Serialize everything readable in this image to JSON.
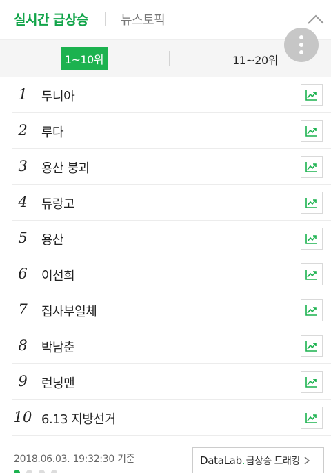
{
  "header": {
    "tab_active": "실시간 급상승",
    "tab_inactive": "뉴스토픽"
  },
  "range": {
    "active": "1~10위",
    "inactive": "11~20위"
  },
  "keywords": [
    {
      "rank": "1",
      "text": "두니아"
    },
    {
      "rank": "2",
      "text": "루다"
    },
    {
      "rank": "3",
      "text": "용산 붕괴"
    },
    {
      "rank": "4",
      "text": "듀랑고"
    },
    {
      "rank": "5",
      "text": "용산"
    },
    {
      "rank": "6",
      "text": "이선희"
    },
    {
      "rank": "7",
      "text": "집사부일체"
    },
    {
      "rank": "8",
      "text": "박남춘"
    },
    {
      "rank": "9",
      "text": "런닝맨"
    },
    {
      "rank": "10",
      "text": "6.13 지방선거"
    }
  ],
  "footer": {
    "timestamp": "2018.06.03. 19:32:30 기준",
    "datalab_brand": "DataLab",
    "datalab_dot": ".",
    "datalab_label": "급상승 트래킹",
    "page_dots": 4,
    "active_dot": 0
  },
  "colors": {
    "accent": "#1cb24f",
    "tab_active": "#11a449"
  },
  "icons": {
    "collapse": "chevron-up-icon",
    "more": "more-vertical-icon",
    "trend": "trend-chart-icon",
    "datalab_arrow": "chevron-right-icon"
  }
}
